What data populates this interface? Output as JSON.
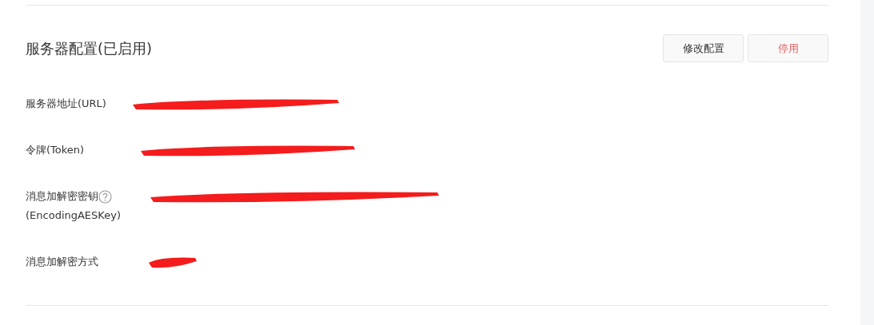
{
  "title": "服务器配置(已启用)",
  "buttons": [
    {
      "label": "修改配置",
      "kind": "default"
    },
    {
      "label": "停用",
      "kind": "danger"
    }
  ],
  "fields": [
    {
      "label": "服务器地址(URL)",
      "help": false,
      "redacted": true
    },
    {
      "label": "令牌(Token)",
      "help": false,
      "redacted": true
    },
    {
      "label": "消息加解密密钥",
      "sublabel": "(EncodingAESKey)",
      "help": true,
      "redacted": true
    },
    {
      "label": "消息加解密方式",
      "help": false,
      "redacted": true
    }
  ]
}
